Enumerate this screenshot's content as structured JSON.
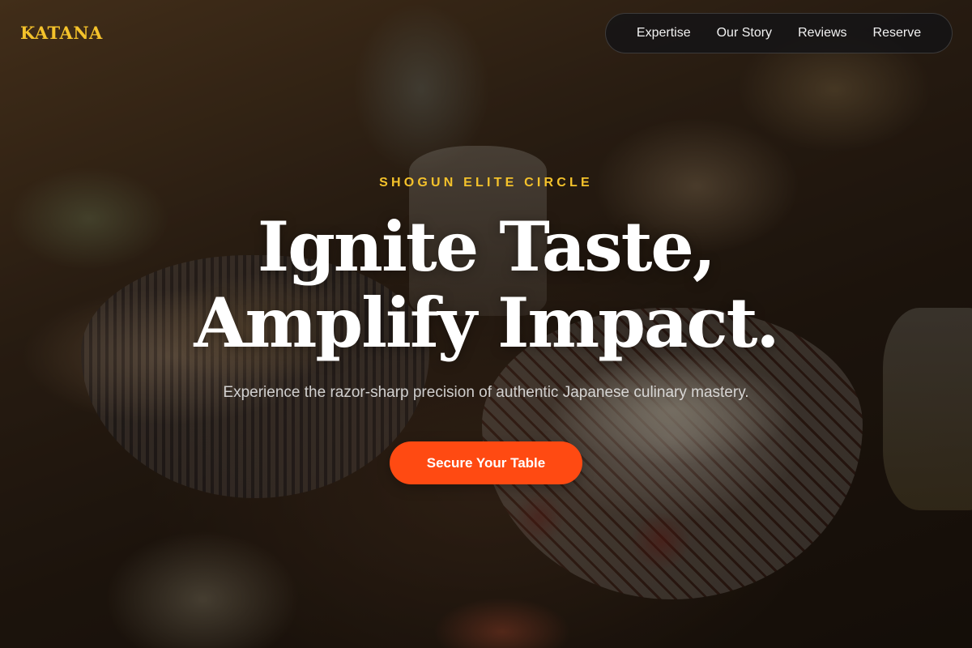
{
  "brand": {
    "logo_text": "KATANA",
    "accent_color": "#f4c22b",
    "cta_color": "#ff4a12"
  },
  "nav": {
    "items": [
      {
        "label": "Expertise"
      },
      {
        "label": "Our Story"
      },
      {
        "label": "Reviews"
      },
      {
        "label": "Reserve"
      }
    ]
  },
  "hero": {
    "eyebrow": "SHOGUN ELITE CIRCLE",
    "headline_line1": "Ignite Taste,",
    "headline_line2": "Amplify Impact.",
    "subtitle": "Experience the razor-sharp precision of authentic Japanese culinary mastery.",
    "cta_label": "Secure Your Table"
  }
}
